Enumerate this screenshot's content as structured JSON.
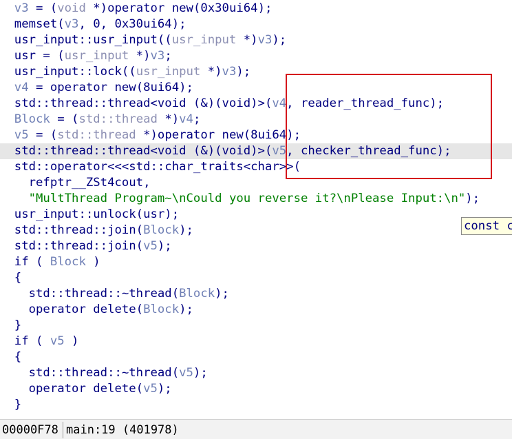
{
  "colors": {
    "keyword": "#000080",
    "variable": "#6f7fb5",
    "string": "#008000",
    "current_line_bg": "#e6e6e6",
    "highlight_box": "#d5161c",
    "tooltip_bg": "#ffffe1"
  },
  "code_lines": [
    {
      "highlight": false,
      "segments": [
        {
          "t": "  v3",
          "c": "var"
        },
        {
          "t": " = (",
          "c": "kw"
        },
        {
          "t": "void",
          "c": "typ"
        },
        {
          "t": " *)operator new(0x30ui64);",
          "c": "kw"
        }
      ]
    },
    {
      "highlight": false,
      "segments": [
        {
          "t": "  memset(",
          "c": "kw"
        },
        {
          "t": "v3",
          "c": "var"
        },
        {
          "t": ", 0, 0x30ui64);",
          "c": "kw"
        }
      ]
    },
    {
      "highlight": false,
      "segments": [
        {
          "t": "  usr_input::usr_input((",
          "c": "kw"
        },
        {
          "t": "usr_input",
          "c": "typ"
        },
        {
          "t": " *)",
          "c": "kw"
        },
        {
          "t": "v3",
          "c": "var"
        },
        {
          "t": ");",
          "c": "kw"
        }
      ]
    },
    {
      "highlight": false,
      "segments": [
        {
          "t": "  usr = (",
          "c": "kw"
        },
        {
          "t": "usr_input",
          "c": "typ"
        },
        {
          "t": " *)",
          "c": "kw"
        },
        {
          "t": "v3",
          "c": "var"
        },
        {
          "t": ";",
          "c": "kw"
        }
      ]
    },
    {
      "highlight": false,
      "segments": [
        {
          "t": "  usr_input::lock((",
          "c": "kw"
        },
        {
          "t": "usr_input",
          "c": "typ"
        },
        {
          "t": " *)",
          "c": "kw"
        },
        {
          "t": "v3",
          "c": "var"
        },
        {
          "t": ");",
          "c": "kw"
        }
      ]
    },
    {
      "highlight": false,
      "segments": [
        {
          "t": "  v4",
          "c": "var"
        },
        {
          "t": " = operator new(8ui64);",
          "c": "kw"
        }
      ]
    },
    {
      "highlight": false,
      "segments": [
        {
          "t": "  std::thread::thread<void (&)(void)>(",
          "c": "kw"
        },
        {
          "t": "v4",
          "c": "var"
        },
        {
          "t": ", reader_thread_func);",
          "c": "kw"
        }
      ]
    },
    {
      "highlight": false,
      "segments": [
        {
          "t": "  Block",
          "c": "var"
        },
        {
          "t": " = (",
          "c": "kw"
        },
        {
          "t": "std::thread",
          "c": "typ"
        },
        {
          "t": " *)",
          "c": "kw"
        },
        {
          "t": "v4",
          "c": "var"
        },
        {
          "t": ";",
          "c": "kw"
        }
      ]
    },
    {
      "highlight": false,
      "segments": [
        {
          "t": "  v5",
          "c": "var"
        },
        {
          "t": " = (",
          "c": "kw"
        },
        {
          "t": "std::thread",
          "c": "typ"
        },
        {
          "t": " *)operator new(8ui64);",
          "c": "kw"
        }
      ]
    },
    {
      "highlight": true,
      "segments": [
        {
          "t": "  std::thread::thread<void (&)(void)>(",
          "c": "kw"
        },
        {
          "t": "v5",
          "c": "var"
        },
        {
          "t": ", checker_thread_func);",
          "c": "kw"
        }
      ]
    },
    {
      "highlight": false,
      "segments": [
        {
          "t": "  std::operator<<<std::char_traits<char>>(",
          "c": "kw"
        }
      ]
    },
    {
      "highlight": false,
      "segments": [
        {
          "t": "    refptr__ZSt4cout,",
          "c": "kw"
        }
      ]
    },
    {
      "highlight": false,
      "segments": [
        {
          "t": "    ",
          "c": "kw"
        },
        {
          "t": "\"MultThread Program~\\nCould you reverse it?\\nPlease Input:\\n\"",
          "c": "str"
        },
        {
          "t": ");",
          "c": "kw"
        }
      ]
    },
    {
      "highlight": false,
      "segments": [
        {
          "t": "  usr_input::unlock(usr);",
          "c": "kw"
        }
      ]
    },
    {
      "highlight": false,
      "segments": [
        {
          "t": "  std::thread::join(",
          "c": "kw"
        },
        {
          "t": "Block",
          "c": "var"
        },
        {
          "t": ");",
          "c": "kw"
        }
      ]
    },
    {
      "highlight": false,
      "segments": [
        {
          "t": "  std::thread::join(",
          "c": "kw"
        },
        {
          "t": "v5",
          "c": "var"
        },
        {
          "t": ");",
          "c": "kw"
        }
      ]
    },
    {
      "highlight": false,
      "segments": [
        {
          "t": "  if ( ",
          "c": "kw"
        },
        {
          "t": "Block",
          "c": "var"
        },
        {
          "t": " )",
          "c": "kw"
        }
      ]
    },
    {
      "highlight": false,
      "segments": [
        {
          "t": "  {",
          "c": "kw"
        }
      ]
    },
    {
      "highlight": false,
      "segments": [
        {
          "t": "    std::thread::~thread(",
          "c": "kw"
        },
        {
          "t": "Block",
          "c": "var"
        },
        {
          "t": ");",
          "c": "kw"
        }
      ]
    },
    {
      "highlight": false,
      "segments": [
        {
          "t": "    operator delete(",
          "c": "kw"
        },
        {
          "t": "Block",
          "c": "var"
        },
        {
          "t": ");",
          "c": "kw"
        }
      ]
    },
    {
      "highlight": false,
      "segments": [
        {
          "t": "  }",
          "c": "kw"
        }
      ]
    },
    {
      "highlight": false,
      "segments": [
        {
          "t": "  if ( ",
          "c": "kw"
        },
        {
          "t": "v5",
          "c": "var"
        },
        {
          "t": " )",
          "c": "kw"
        }
      ]
    },
    {
      "highlight": false,
      "segments": [
        {
          "t": "  {",
          "c": "kw"
        }
      ]
    },
    {
      "highlight": false,
      "segments": [
        {
          "t": "    std::thread::~thread(",
          "c": "kw"
        },
        {
          "t": "v5",
          "c": "var"
        },
        {
          "t": ");",
          "c": "kw"
        }
      ]
    },
    {
      "highlight": false,
      "segments": [
        {
          "t": "    operator delete(",
          "c": "kw"
        },
        {
          "t": "v5",
          "c": "var"
        },
        {
          "t": ");",
          "c": "kw"
        }
      ]
    },
    {
      "highlight": false,
      "segments": [
        {
          "t": "  }",
          "c": "kw"
        }
      ]
    }
  ],
  "tooltip": {
    "text": "const c"
  },
  "status": {
    "position": "00000F78",
    "address": "main:19 (401978)"
  }
}
